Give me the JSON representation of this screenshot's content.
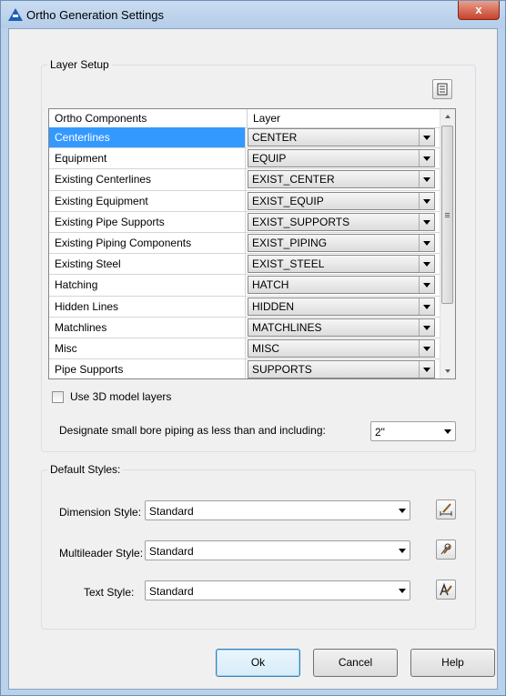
{
  "window": {
    "title": "Ortho Generation Settings",
    "close_label": "x"
  },
  "layer_setup": {
    "legend": "Layer Setup",
    "columns": [
      "Ortho Components",
      "Layer"
    ],
    "rows": [
      {
        "component": "Centerlines",
        "layer": "CENTER"
      },
      {
        "component": "Equipment",
        "layer": "EQUIP"
      },
      {
        "component": "Existing Centerlines",
        "layer": "EXIST_CENTER"
      },
      {
        "component": "Existing Equipment",
        "layer": "EXIST_EQUIP"
      },
      {
        "component": "Existing Pipe Supports",
        "layer": "EXIST_SUPPORTS"
      },
      {
        "component": "Existing Piping Components",
        "layer": "EXIST_PIPING"
      },
      {
        "component": "Existing Steel",
        "layer": "EXIST_STEEL"
      },
      {
        "component": "Hatching",
        "layer": "HATCH"
      },
      {
        "component": "Hidden Lines",
        "layer": "HIDDEN"
      },
      {
        "component": "Matchlines",
        "layer": "MATCHLINES"
      },
      {
        "component": "Misc",
        "layer": "MISC"
      },
      {
        "component": "Pipe Supports",
        "layer": "SUPPORTS"
      }
    ],
    "use_3d_label": "Use 3D model layers",
    "small_bore_label": "Designate small bore piping as less than and including:",
    "small_bore_value": "2\""
  },
  "default_styles": {
    "legend": "Default Styles:",
    "dimension_label": "Dimension Style:",
    "dimension_value": "Standard",
    "multileader_label": "Multileader Style:",
    "multileader_value": "Standard",
    "text_label": "Text Style:",
    "text_value": "Standard"
  },
  "buttons": {
    "ok": "Ok",
    "cancel": "Cancel",
    "help": "Help"
  }
}
